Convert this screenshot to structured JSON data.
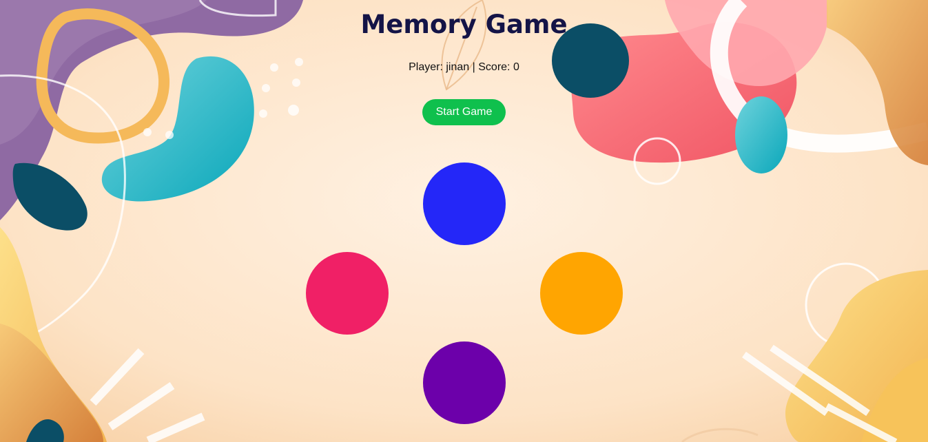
{
  "game": {
    "title": "Memory Game",
    "player_label": "Player:",
    "player_name": "jinan",
    "separator": "|",
    "score_label": "Score:",
    "score": "0",
    "start_label": "Start Game"
  },
  "colors": {
    "title": "#141447",
    "start_button": "#0fc04d",
    "pad_top": "#2427f8",
    "pad_left": "#f02066",
    "pad_right": "#ffa501",
    "pad_bottom": "#6c00aa"
  }
}
